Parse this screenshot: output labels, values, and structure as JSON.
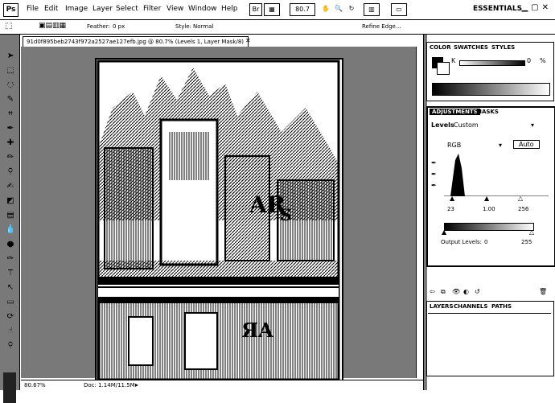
{
  "app": {
    "logo": "Ps"
  },
  "menus": [
    "File",
    "Edit",
    "Image",
    "Layer",
    "Select",
    "Filter",
    "View",
    "Window",
    "Help"
  ],
  "menubar": {
    "zoom": "80.7",
    "workspace": "ESSENTIALS"
  },
  "options": {
    "feather_label": "Feather:",
    "feather_value": "0 px",
    "style_label": "Style:",
    "style_value": "Normal",
    "refine_edge": "Refine Edge..."
  },
  "document": {
    "tab_title": "91d0f895beb2743f972a2527ae127efb.jpg @ 80.7% (Levels 1, Layer Mask/8)"
  },
  "status": {
    "zoom": "80.67%",
    "doc_info": "Doc: 1.14M/11.5M"
  },
  "color_panel": {
    "tabs": [
      "COLOR",
      "SWATCHES",
      "STYLES"
    ],
    "k_label": "K",
    "k_value": "0",
    "pct": "%"
  },
  "adjustments": {
    "tabs": [
      "ADJUSTMENTS",
      "MASKS"
    ],
    "title": "Levels",
    "preset": "Custom",
    "channel": "RGB",
    "auto": "Auto",
    "input_values": [
      "23",
      "1.00",
      "256"
    ],
    "output_label": "Output Levels:",
    "output_values": [
      "0",
      "255"
    ]
  },
  "layers_panel": {
    "tabs": [
      "LAYERS",
      "CHANNELS",
      "PATHS"
    ]
  },
  "colors": {
    "ink": "#000000",
    "paper": "#ffffff"
  }
}
